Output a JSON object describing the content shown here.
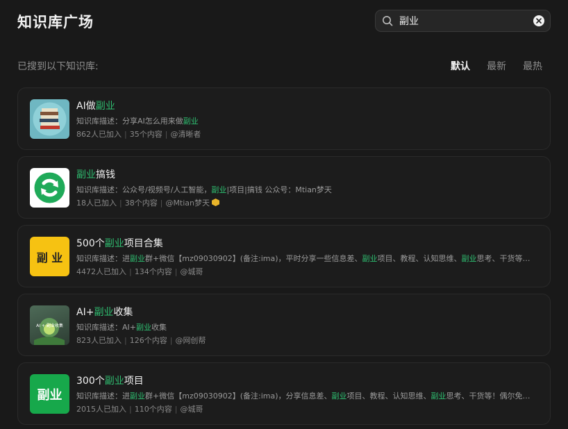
{
  "header": {
    "title": "知识库广场",
    "search_value": "副业"
  },
  "results": {
    "label": "已搜到以下知识库:"
  },
  "sort_tabs": [
    "默认",
    "最新",
    "最热"
  ],
  "desc_prefix": "知识库描述：",
  "cards": [
    {
      "name_before": "AI做",
      "name_hl": "副业",
      "name_after": "",
      "desc": "分享AI怎么用来做",
      "desc_hl": "副业",
      "members": "862人已加入",
      "contents": "35个内容",
      "author": "@清晰者",
      "thumb_icon": "books-icon"
    },
    {
      "name_before": "",
      "name_hl": "副业",
      "name_after": "搞钱",
      "desc_parts": [
        "公众号/视频号/人工智能，",
        "副业",
        "|项目|搞钱 公众号：Mtian梦天"
      ],
      "members": "18人已加入",
      "contents": "38个内容",
      "author": "@Mtian梦天",
      "thumb_icon": "green-circle-arrow-icon"
    },
    {
      "name_before": "500个",
      "name_hl": "副业",
      "name_after": "项目合集",
      "desc_parts": [
        "进",
        "副业",
        "群+微信【mz09030902】(备注:ima)，平时分享一些信息差、",
        "副业",
        "项目、教程、认知思维、",
        "副业",
        "思考、干货等！..."
      ],
      "members": "4472人已加入",
      "contents": "134个内容",
      "author": "@城哥",
      "thumb_text": "副 业"
    },
    {
      "name_before": "AI+",
      "name_hl": "副业",
      "name_after": "收集",
      "desc_parts": [
        "AI+",
        "副业",
        "收集"
      ],
      "members": "823人已加入",
      "contents": "126个内容",
      "author": "@网创帮",
      "thumb_text": "AI + 副业收集"
    },
    {
      "name_before": "300个",
      "name_hl": "副业",
      "name_after": "项目",
      "desc_parts": [
        "进",
        "副业",
        "群+微信【mz09030902】(备注:ima)，分享信息差、",
        "副业",
        "项目、教程、认知思维、",
        "副业",
        "思考、干货等！偶尔免费..."
      ],
      "members": "2015人已加入",
      "contents": "110个内容",
      "author": "@城哥",
      "thumb_text": "副业"
    }
  ],
  "colors": {
    "background": "#191919",
    "highlight": "#2fbf71",
    "card_border": "#2a2a2a"
  }
}
